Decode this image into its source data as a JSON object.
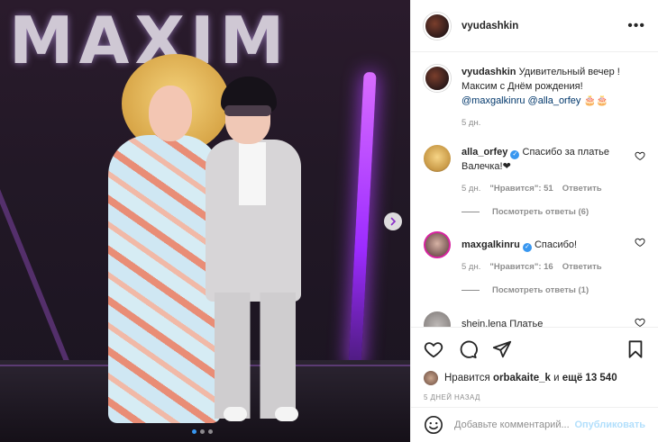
{
  "media": {
    "backdrop_logo": "MAXIM",
    "slides": 3,
    "active_slide": 1
  },
  "header": {
    "username": "vyudashkin",
    "more_label": "•••"
  },
  "caption": {
    "username": "vyudashkin",
    "text": "Удивительный вечер ! Максим с Днём рождения!",
    "mention1": "@maxgalkinru",
    "mention2": "@alla_orfey",
    "emoji": "🎂🎂",
    "time": "5 дн."
  },
  "comments": [
    {
      "username": "alla_orfey",
      "verified": true,
      "text": "Спасибо за платье Валечка!❤",
      "time": "5 дн.",
      "likes": "\"Нравится\": 51",
      "reply_label": "Ответить",
      "view_replies": "Посмотреть ответы (6)"
    },
    {
      "username": "maxgalkinru",
      "verified": true,
      "text": "Спасибо!",
      "time": "5 дн.",
      "likes": "\"Нравится\": 16",
      "reply_label": "Ответить",
      "view_replies": "Посмотреть ответы (1)"
    },
    {
      "username": "shein.lena",
      "verified": false,
      "text": "Платье",
      "time": "",
      "likes": "",
      "reply_label": "",
      "view_replies": ""
    }
  ],
  "likes": {
    "prefix": "Нравится",
    "user": "orbakaite_k",
    "middle": "и",
    "count": "ещё 13 540"
  },
  "date": "5 ДНЕЙ НАЗАД",
  "add_comment": {
    "placeholder": "Добавьте комментарий...",
    "publish_label": "Опубликовать"
  },
  "colors": {
    "link": "#00376b",
    "verified": "#3897f0",
    "publish_disabled": "#b2dffc",
    "muted": "#8e8e8e"
  },
  "icons": [
    "heart-icon",
    "comment-icon",
    "share-icon",
    "bookmark-icon",
    "emoji-icon",
    "chevron-right-icon",
    "verified-icon",
    "more-icon"
  ]
}
